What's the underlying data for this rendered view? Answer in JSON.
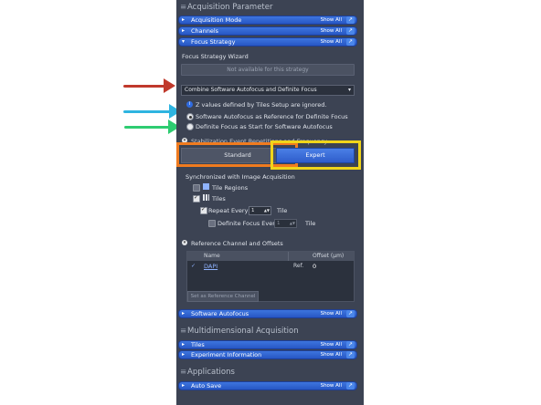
{
  "sections": {
    "acquisition": "Acquisition Parameter",
    "multidim": "Multidimensional Acquisition",
    "applications": "Applications"
  },
  "bars": {
    "acq_mode": {
      "label": "Acquisition Mode",
      "show": "Show All"
    },
    "channels": {
      "label": "Channels",
      "show": "Show All"
    },
    "focus_strategy": {
      "label": "Focus Strategy",
      "show": "Show All"
    },
    "software_autofocus": {
      "label": "Software Autofocus",
      "show": "Show All"
    },
    "tiles": {
      "label": "Tiles",
      "show": "Show All"
    },
    "experiment_info": {
      "label": "Experiment Information",
      "show": "Show All"
    },
    "auto_save": {
      "label": "Auto Save",
      "show": "Show All"
    }
  },
  "focus": {
    "wizard_title": "Focus Strategy Wizard",
    "not_available": "Not available for this strategy",
    "strategy_selected": "Combine Software Autofocus and Definite Focus",
    "info": "Z values defined by Tiles Setup are ignored.",
    "radio1": "Software Autofocus as Reference for Definite Focus",
    "radio2": "Definite Focus as Start for Software Autofocus",
    "stabilization": "Stabilization Event Repetitions and Frequency",
    "btn_standard": "Standard",
    "btn_expert": "Expert",
    "sync_title": "Synchronized with Image Acquisition",
    "tile_regions": "Tile Regions",
    "tiles": "Tiles",
    "repeat_every": "Repeat Every",
    "repeat_value": "1",
    "repeat_unit": "Tile",
    "definite_every": "Definite Focus Every",
    "definite_value": "1",
    "definite_unit": "Tile",
    "ref_title": "Reference Channel and Offsets",
    "col_name": "Name",
    "col_offset": "Offset (µm)",
    "row_name": "DAPI",
    "row_ref": "Ref.",
    "row_offset": "0",
    "set_ref_button": "Set as Reference Channel"
  },
  "colors": {
    "annotation_red": "#c0392b",
    "annotation_blue": "#2eb4e0",
    "annotation_green": "#2ecc71",
    "annotation_orange": "#f07b1f",
    "annotation_yellow": "#f1d51a",
    "panel_bg": "#3c4353",
    "bar_blue": "#2f62d3"
  }
}
